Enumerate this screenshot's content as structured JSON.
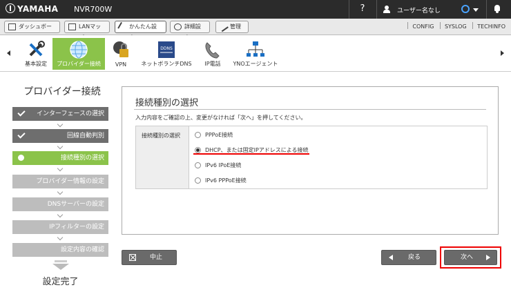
{
  "header": {
    "brand": "YAMAHA",
    "model": "NVR700W",
    "help": "?",
    "user": "ユーザー名なし"
  },
  "tabs": [
    {
      "label": "ダッシュボード"
    },
    {
      "label": "LANマップ"
    },
    {
      "label": "かんたん設定"
    },
    {
      "label": "詳細設定"
    },
    {
      "label": "管理"
    }
  ],
  "toplinks": [
    "CONFIG",
    "SYSLOG",
    "TECHINFO"
  ],
  "nav": [
    {
      "label": "基本設定",
      "icon": "tools-icon"
    },
    {
      "label": "プロバイダー接続",
      "icon": "globe-icon"
    },
    {
      "label": "VPN",
      "icon": "lock-icon"
    },
    {
      "label": "ネットボランチDNS",
      "icon": "dns-icon"
    },
    {
      "label": "IP電話",
      "icon": "phone-icon"
    },
    {
      "label": "YNOエージェント",
      "icon": "network-icon"
    }
  ],
  "wizard": {
    "title": "プロバイダー接続",
    "steps": [
      {
        "label": "インターフェースの選択",
        "state": "done"
      },
      {
        "label": "回線自動判別",
        "state": "done"
      },
      {
        "label": "接続種別の選択",
        "state": "current"
      },
      {
        "label": "プロバイダー情報の設定",
        "state": "todo"
      },
      {
        "label": "DNSサーバーの設定",
        "state": "todo"
      },
      {
        "label": "IPフィルターの設定",
        "state": "todo"
      },
      {
        "label": "設定内容の確認",
        "state": "todo"
      }
    ],
    "complete": "設定完了"
  },
  "panel": {
    "title": "接続種別の選択",
    "description": "入力内容をご確認の上、変更がなければ「次へ」を押してください。",
    "field_label": "接続種別の選択",
    "options": [
      {
        "label": "PPPoE接続",
        "selected": false
      },
      {
        "label": "DHCP、または固定IPアドレスによる接続",
        "selected": true
      },
      {
        "label": "IPv6 IPoE接続",
        "selected": false
      },
      {
        "label": "IPv6 PPPoE接続",
        "selected": false
      }
    ]
  },
  "buttons": {
    "cancel": "中止",
    "back": "戻る",
    "next": "次へ"
  },
  "colors": {
    "accent_green": "#8bc34a",
    "highlight_red": "#e00000",
    "topbar": "#2b2b2b"
  }
}
